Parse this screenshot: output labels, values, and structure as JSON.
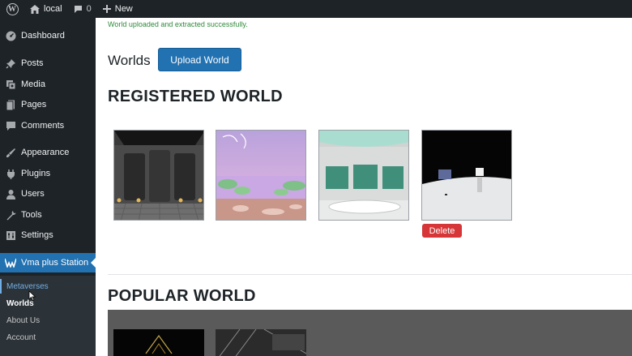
{
  "adminbar": {
    "site_name": "local",
    "comments_count": "0",
    "new_label": "New"
  },
  "sidebar": {
    "items": [
      {
        "label": "Dashboard",
        "icon": "dashboard-icon"
      },
      {
        "label": "Posts",
        "icon": "pin-icon"
      },
      {
        "label": "Media",
        "icon": "media-icon"
      },
      {
        "label": "Pages",
        "icon": "pages-icon"
      },
      {
        "label": "Comments",
        "icon": "comment-icon"
      },
      {
        "label": "Appearance",
        "icon": "brush-icon"
      },
      {
        "label": "Plugins",
        "icon": "plugin-icon"
      },
      {
        "label": "Users",
        "icon": "user-icon"
      },
      {
        "label": "Tools",
        "icon": "wrench-icon"
      },
      {
        "label": "Settings",
        "icon": "settings-icon"
      },
      {
        "label": "Vma plus Station",
        "icon": "vma-icon"
      }
    ],
    "submenu": [
      "Metaverses",
      "Worlds",
      "About Us",
      "Account"
    ]
  },
  "main": {
    "notice": "World uploaded and extracted successfully.",
    "title": "Worlds",
    "upload_button": "Upload World",
    "registered_heading": "REGISTERED WORLD",
    "delete_button": "Delete",
    "popular_heading": "POPULAR WORLD"
  }
}
